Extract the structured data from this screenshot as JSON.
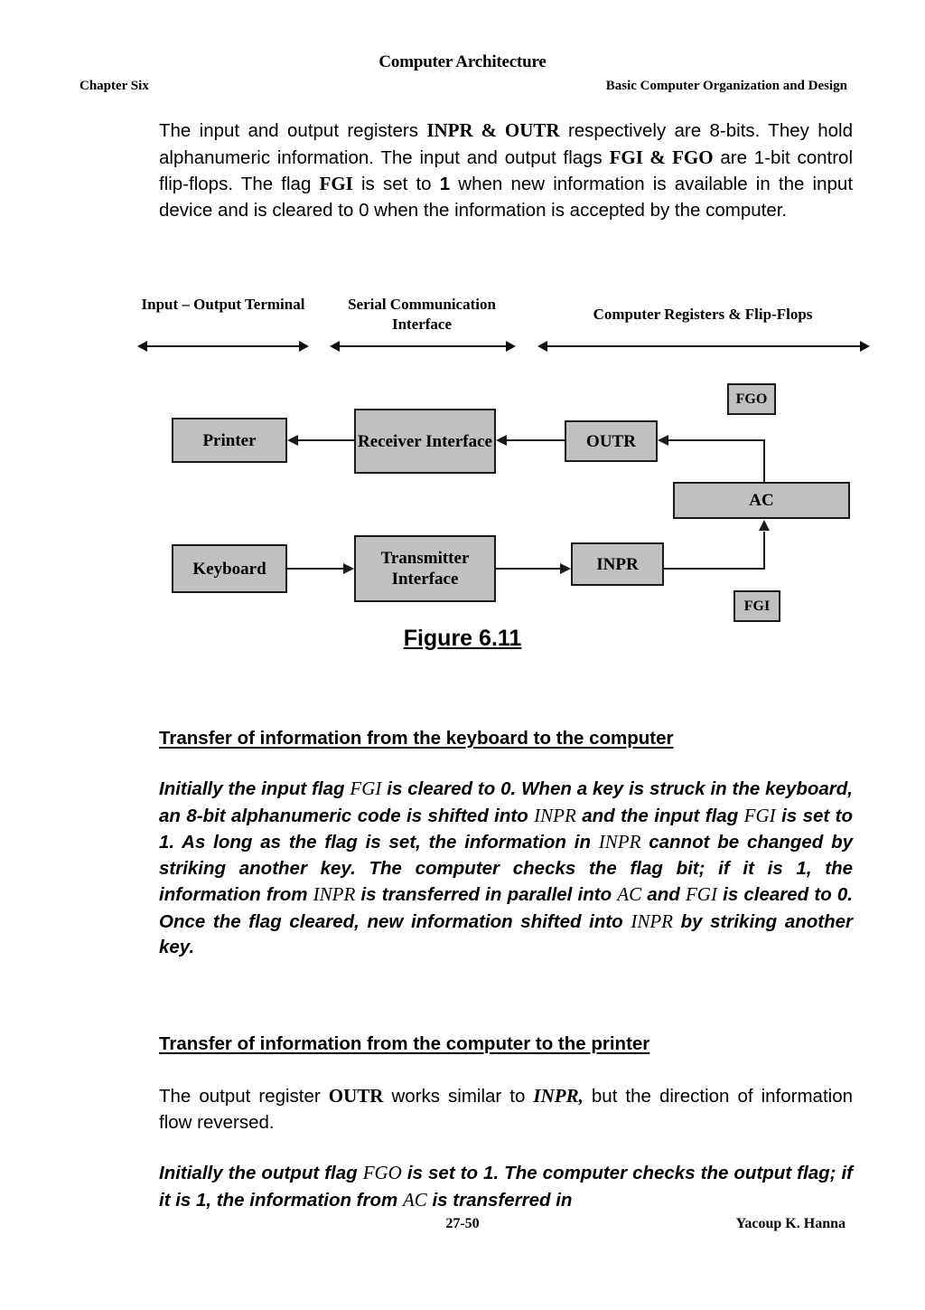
{
  "header": {
    "doc_title": "Computer Architecture",
    "chapter": "Chapter Six",
    "section": "Basic Computer Organization and Design"
  },
  "intro_paragraph": {
    "p1": "The input and output registers ",
    "inpr_outr": "INPR & OUTR",
    "p2": " respectively are 8-bits. They hold alphanumeric information. The input and output flags ",
    "fgi_fgo": "FGI & FGO",
    "p3": " are 1-bit control flip-flops. The flag ",
    "fgi": "FGI",
    "p4": " is set to ",
    "one": "1",
    "p5": " when new information is available in the input device and is cleared to 0 when the information is accepted by the computer."
  },
  "figure": {
    "column_headers": [
      "Input – Output Terminal",
      "Serial Communication Interface",
      "Computer Registers & Flip-Flops"
    ],
    "boxes": {
      "printer": "Printer",
      "receiver_interface": "Receiver Interface",
      "outr": "OUTR",
      "fgo": "FGO",
      "ac": "AC",
      "keyboard": "Keyboard",
      "transmitter_interface": "Transmitter Interface",
      "inpr": "INPR",
      "fgi": "FGI"
    },
    "caption": "Figure 6.11",
    "box_fill_color": "#c0c0c0",
    "box_border_color": "#1a1a1a"
  },
  "sections": {
    "keyboard_heading": "Transfer of information from the keyboard to the computer",
    "keyboard_body": {
      "t1": "Initially the input flag ",
      "r1": "FGI",
      "t2": " is cleared to 0. When a key is struck in the keyboard, an 8-bit alphanumeric code is shifted into ",
      "r2": "INPR",
      "t3": " and the input flag ",
      "r3": "FGI",
      "t4": " is set to 1. As long as the flag is set, the information in ",
      "r4": "INPR",
      "t5": " cannot be changed by striking another key. The computer checks the flag bit; if it is 1, the information from ",
      "r5": "INPR",
      "t6": " is transferred in parallel into ",
      "r6": "AC",
      "t7": " and ",
      "r7": "FGI",
      "t8": " is cleared to 0. Once the flag cleared, new information shifted into ",
      "r8": "INPR",
      "t9": " by striking another key."
    },
    "printer_heading": "Transfer of information from the computer to the printer",
    "printer_body": {
      "t1": "The output register ",
      "b1": "OUTR",
      "t2": " works similar to ",
      "r1": "INPR,",
      "t3": " but the direction of information flow reversed."
    },
    "fgo_body": {
      "t1": "Initially the output flag ",
      "r1": "FGO",
      "t2": " is set to 1. The computer checks the output flag; if it is 1, the information from ",
      "r2": "AC",
      "t3": " is transferred in"
    }
  },
  "footer": {
    "page_number": "27-50",
    "author": "Yacoup K. Hanna"
  }
}
